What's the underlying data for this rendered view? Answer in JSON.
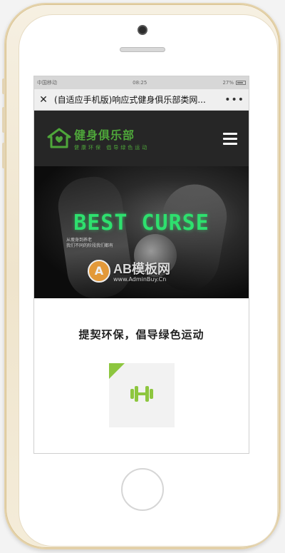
{
  "status_bar": {
    "carrier": "中国移动",
    "time": "08:25",
    "battery": "27%"
  },
  "wechat_nav": {
    "close_icon": "close-icon",
    "title": "(自适应手机版)响应式健身俱乐部类网...",
    "more_icon": "more-icon"
  },
  "site_header": {
    "logo_name": "健身俱乐部",
    "logo_slogan": "健康环保 倡导绿色运动",
    "menu_icon": "hamburger-menu-icon"
  },
  "banner": {
    "headline": "BEST CURSE",
    "subline1": "从瘦身到养老",
    "subline2": "我们不同的阶段我们都有",
    "watermark_letter": "A",
    "watermark_brand": "AB模板网",
    "watermark_url": "www.AdminBuy.Cn"
  },
  "content": {
    "section_title": "提契环保，倡导绿色运动",
    "feature_icon": "dumbbell-icon"
  },
  "colors": {
    "brand_green": "#4ea63a",
    "accent_green": "#8dc63f",
    "header_bg": "#262626"
  }
}
